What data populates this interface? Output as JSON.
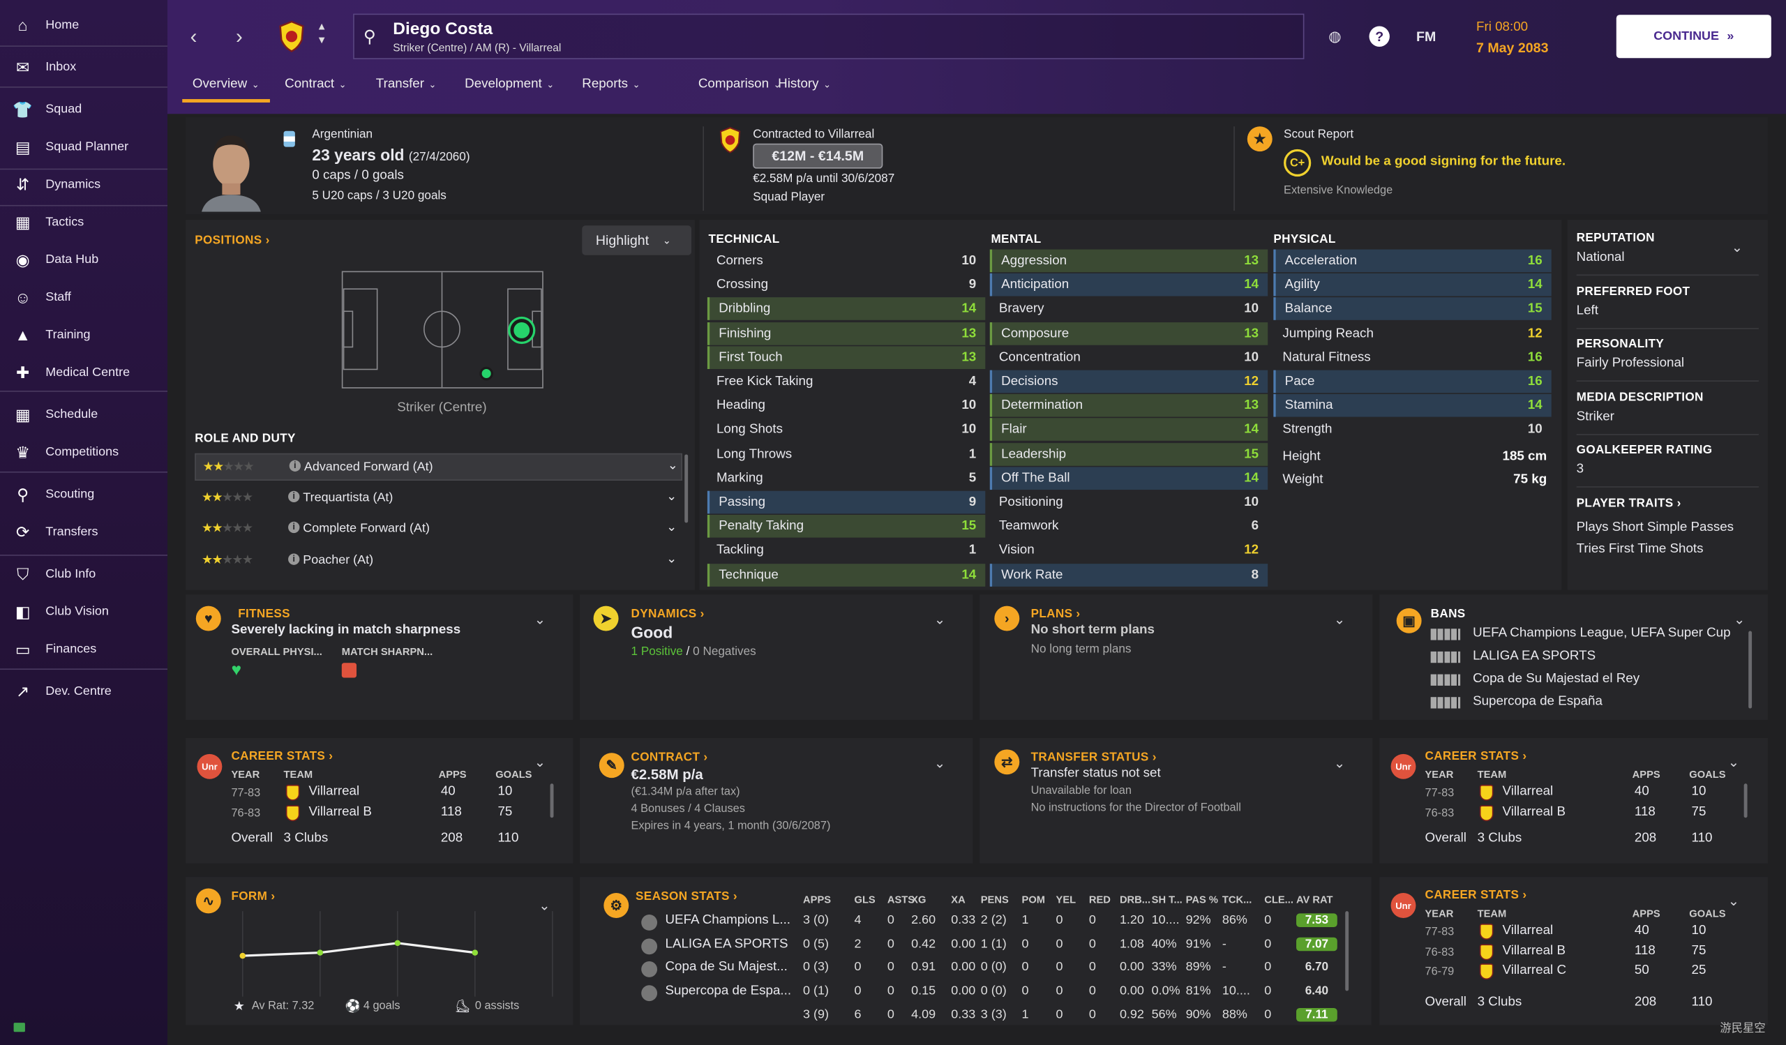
{
  "nav": [
    {
      "label": "Home",
      "icon": "home-icon"
    },
    {
      "label": "Inbox",
      "icon": "inbox-icon"
    },
    {
      "label": "Squad",
      "icon": "squad-icon"
    },
    {
      "label": "Squad Planner",
      "icon": "clipboard-icon"
    },
    {
      "label": "Dynamics",
      "icon": "dynamics-icon"
    },
    {
      "label": "Tactics",
      "icon": "tactics-icon"
    },
    {
      "label": "Data Hub",
      "icon": "data-hub-icon"
    },
    {
      "label": "Staff",
      "icon": "staff-icon"
    },
    {
      "label": "Training",
      "icon": "training-icon"
    },
    {
      "label": "Medical Centre",
      "icon": "medical-icon"
    },
    {
      "label": "Schedule",
      "icon": "calendar-icon"
    },
    {
      "label": "Competitions",
      "icon": "trophy-icon"
    },
    {
      "label": "Scouting",
      "icon": "search-icon"
    },
    {
      "label": "Transfers",
      "icon": "transfers-icon"
    },
    {
      "label": "Club Info",
      "icon": "shield-icon"
    },
    {
      "label": "Club Vision",
      "icon": "vision-icon"
    },
    {
      "label": "Finances",
      "icon": "finances-icon"
    },
    {
      "label": "Dev. Centre",
      "icon": "dev-centre-icon"
    }
  ],
  "header": {
    "player_name": "Diego Costa",
    "player_sub": "Striker (Centre) / AM (R) - Villarreal",
    "fm": "FM",
    "time": "Fri 08:00",
    "date": "7 May 2083",
    "continue": "CONTINUE",
    "tabs": [
      "Overview",
      "Contract",
      "Transfer",
      "Development",
      "Reports",
      "Comparison",
      "History"
    ]
  },
  "bio": {
    "nationality": "Argentinian",
    "age": "23 years old",
    "dob": "(27/4/2060)",
    "caps": "0 caps / 0 goals",
    "u20": "5 U20 caps / 3 U20 goals",
    "contracted": "Contracted to Villarreal",
    "value": "€12M - €14.5M",
    "wage": "€2.58M p/a until 30/6/2087",
    "status": "Squad Player",
    "scout_title": "Scout Report",
    "scout_grade": "C+",
    "scout_text": "Would be a good signing for the future.",
    "knowledge": "Extensive Knowledge"
  },
  "positions": {
    "title": "POSITIONS",
    "highlight": "Highlight",
    "position": "Striker (Centre)",
    "role_title": "ROLE AND DUTY",
    "roles": [
      "Advanced Forward (At)",
      "Trequartista (At)",
      "Complete Forward (At)",
      "Poacher (At)"
    ]
  },
  "technical": {
    "title": "TECHNICAL",
    "rows": [
      [
        "Corners",
        "10"
      ],
      [
        "Crossing",
        "9"
      ],
      [
        "Dribbling",
        "14"
      ],
      [
        "Finishing",
        "13"
      ],
      [
        "First Touch",
        "13"
      ],
      [
        "Free Kick Taking",
        "4"
      ],
      [
        "Heading",
        "10"
      ],
      [
        "Long Shots",
        "10"
      ],
      [
        "Long Throws",
        "1"
      ],
      [
        "Marking",
        "5"
      ],
      [
        "Passing",
        "9"
      ],
      [
        "Penalty Taking",
        "15"
      ],
      [
        "Tackling",
        "1"
      ],
      [
        "Technique",
        "14"
      ]
    ]
  },
  "mental": {
    "title": "MENTAL",
    "rows": [
      [
        "Aggression",
        "13"
      ],
      [
        "Anticipation",
        "14"
      ],
      [
        "Bravery",
        "10"
      ],
      [
        "Composure",
        "13"
      ],
      [
        "Concentration",
        "10"
      ],
      [
        "Decisions",
        "12"
      ],
      [
        "Determination",
        "13"
      ],
      [
        "Flair",
        "14"
      ],
      [
        "Leadership",
        "15"
      ],
      [
        "Off The Ball",
        "14"
      ],
      [
        "Positioning",
        "10"
      ],
      [
        "Teamwork",
        "6"
      ],
      [
        "Vision",
        "12"
      ],
      [
        "Work Rate",
        "8"
      ]
    ]
  },
  "physical": {
    "title": "PHYSICAL",
    "rows": [
      [
        "Acceleration",
        "16"
      ],
      [
        "Agility",
        "14"
      ],
      [
        "Balance",
        "15"
      ],
      [
        "Jumping Reach",
        "12"
      ],
      [
        "Natural Fitness",
        "16"
      ],
      [
        "Pace",
        "16"
      ],
      [
        "Stamina",
        "14"
      ],
      [
        "Strength",
        "10"
      ]
    ],
    "height_label": "Height",
    "height": "185 cm",
    "weight_label": "Weight",
    "weight": "75 kg"
  },
  "info": [
    {
      "title": "REPUTATION",
      "value": "National"
    },
    {
      "title": "PREFERRED FOOT",
      "value": "Left"
    },
    {
      "title": "PERSONALITY",
      "value": "Fairly Professional"
    },
    {
      "title": "MEDIA DESCRIPTION",
      "value": "Striker"
    },
    {
      "title": "GOALKEEPER RATING",
      "value": "3"
    }
  ],
  "traits": {
    "title": "PLAYER TRAITS",
    "items": [
      "Plays Short Simple Passes",
      "Tries First Time Shots"
    ]
  },
  "fitness": {
    "title": "FITNESS",
    "text": "Severely lacking in match sharpness",
    "l1": "OVERALL PHYSI...",
    "l2": "MATCH SHARPN..."
  },
  "dynamics": {
    "title": "DYNAMICS",
    "value": "Good",
    "positives": "1 Positive",
    "sep": "/",
    "negatives": "0 Negatives"
  },
  "plans": {
    "title": "PLANS",
    "line1": "No short term plans",
    "line2": "No long term plans"
  },
  "bans": {
    "title": "BANS",
    "items": [
      "UEFA Champions League, UEFA Super Cup",
      "LALIGA EA SPORTS",
      "Copa de Su Majestad el Rey",
      "Supercopa de España"
    ]
  },
  "career": {
    "title": "CAREER STATS",
    "badge": "Unr",
    "h_year": "YEAR",
    "h_team": "TEAM",
    "h_apps": "APPS",
    "h_goals": "GOALS",
    "rows": [
      [
        "77-83",
        "Villarreal",
        "40",
        "10"
      ],
      [
        "76-83",
        "Villarreal B",
        "118",
        "75"
      ],
      [
        "76-79",
        "Villarreal C",
        "50",
        "25"
      ]
    ],
    "overall": "Overall",
    "clubs": "3 Clubs",
    "total_apps": "208",
    "total_goals": "110"
  },
  "contract": {
    "title": "CONTRACT",
    "wage": "€2.58M p/a",
    "after_tax": "(€1.34M p/a after tax)",
    "clauses": "4 Bonuses / 4 Clauses",
    "expires": "Expires in 4 years, 1 month (30/6/2087)"
  },
  "transfer": {
    "title": "TRANSFER STATUS",
    "status": "Transfer status not set",
    "loan": "Unavailable for loan",
    "dof": "No instructions for the Director of Football"
  },
  "form": {
    "title": "FORM",
    "avrat": "Av Rat: 7.32",
    "goals": "4 goals",
    "assists": "0 assists"
  },
  "season": {
    "title": "SEASON STATS",
    "headers": [
      "APPS",
      "GLS",
      "ASTS",
      "XG",
      "XA",
      "PENS",
      "POM",
      "YEL",
      "RED",
      "DRB...",
      "SH T...",
      "PAS %",
      "TCK...",
      "CLE...",
      "AV RAT"
    ],
    "rows": [
      {
        "comp": "UEFA Champions L...",
        "v": [
          "3 (0)",
          "4",
          "0",
          "2.60",
          "0.33",
          "2 (2)",
          "1",
          "0",
          "0",
          "1.20",
          "10....",
          "92%",
          "86%",
          "0"
        ],
        "rat": "7.53",
        "rc": "#5aa02c"
      },
      {
        "comp": "LALIGA EA SPORTS",
        "v": [
          "0 (5)",
          "2",
          "0",
          "0.42",
          "0.00",
          "1 (1)",
          "0",
          "0",
          "0",
          "1.08",
          "40%",
          "91%",
          "-",
          "0"
        ],
        "rat": "7.07",
        "rc": "#5aa02c"
      },
      {
        "comp": "Copa de Su Majest...",
        "v": [
          "0 (3)",
          "0",
          "0",
          "0.91",
          "0.00",
          "0 (0)",
          "0",
          "0",
          "0",
          "0.00",
          "33%",
          "89%",
          "-",
          "0"
        ],
        "rat": "6.70",
        "rc": ""
      },
      {
        "comp": "Supercopa de Espa...",
        "v": [
          "0 (1)",
          "0",
          "0",
          "0.15",
          "0.00",
          "0 (0)",
          "0",
          "0",
          "0",
          "0.00",
          "0.0%",
          "81%",
          "10....",
          "0"
        ],
        "rat": "6.40",
        "rc": ""
      }
    ],
    "total": [
      "3 (9)",
      "6",
      "0",
      "4.09",
      "0.33",
      "3 (3)",
      "1",
      "0",
      "0",
      "0.92",
      "56%",
      "90%",
      "88%",
      "0"
    ],
    "total_rat": "7.11"
  },
  "colors": {
    "accent": "#f5a623",
    "good": "#8fde3a",
    "mid": "#f0d12e",
    "continue": "#5a3da8"
  },
  "chart_data": {
    "type": "line",
    "values": [
      7.1,
      7.2,
      7.5,
      7.2
    ]
  },
  "watermark": "游民星空"
}
